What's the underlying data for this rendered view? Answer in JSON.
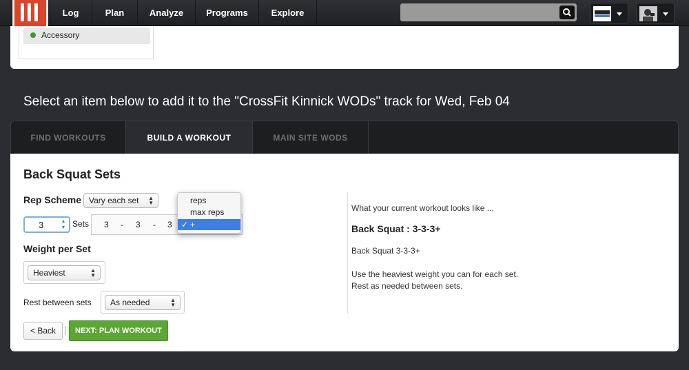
{
  "nav": {
    "items": [
      "Log",
      "Plan",
      "Analyze",
      "Programs",
      "Explore"
    ],
    "search_placeholder": ""
  },
  "top_panel": {
    "accessory_label": "Accessory"
  },
  "heading": "Select an item below to add it to the \"CrossFit Kinnick WODs\" track for Wed, Feb 04",
  "tabs": [
    {
      "label": "FIND WORKOUTS",
      "active": false
    },
    {
      "label": "BUILD A WORKOUT",
      "active": true
    },
    {
      "label": "MAIN SITE WODS",
      "active": false
    }
  ],
  "form": {
    "title": "Back Squat Sets",
    "rep_scheme_label": "Rep Scheme",
    "rep_scheme_value": "Vary each set",
    "sets_value": "3",
    "sets_label": "Sets",
    "set_reps": [
      "3",
      "-",
      "3",
      "-",
      "3"
    ],
    "dropdown_options": [
      "reps",
      "max reps",
      "+"
    ],
    "dropdown_selected": "+",
    "check_mark": "✓",
    "weight_label": "Weight per Set",
    "weight_value": "Heaviest",
    "rest_label": "Rest between sets",
    "rest_value": "As needed",
    "back_label": "< Back",
    "next_label": "NEXT: PLAN WORKOUT"
  },
  "preview": {
    "intro": "What your current workout looks like ...",
    "title": "Back Squat : 3-3-3+",
    "line1": "Back Squat 3-3-3+",
    "line2": "Use the heaviest weight you can for each set.",
    "line3": "Rest as needed between sets."
  },
  "colors": {
    "brand": "#d9442b",
    "accent_green": "#5aa833",
    "selection_blue": "#3d7fe3"
  }
}
